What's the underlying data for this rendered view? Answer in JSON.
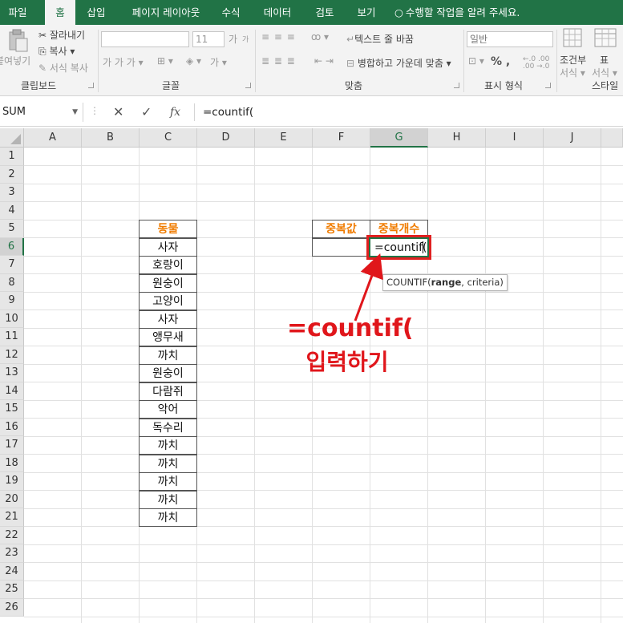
{
  "tabs": [
    {
      "label": "파일",
      "active": false
    },
    {
      "label": "홈",
      "active": true
    },
    {
      "label": "삽입",
      "active": false
    },
    {
      "label": "페이지 레이아웃",
      "active": false
    },
    {
      "label": "수식",
      "active": false
    },
    {
      "label": "데이터",
      "active": false
    },
    {
      "label": "검토",
      "active": false
    },
    {
      "label": "보기",
      "active": false
    }
  ],
  "tell_me": "수행할 작업을 알려 주세요.",
  "ribbon": {
    "clipboard": {
      "paste": "붙여넣기",
      "cut": "잘라내기",
      "copy": "복사 ▾",
      "format_painter": "서식 복사",
      "label": "클립보드"
    },
    "font": {
      "size": "11",
      "grow": "가",
      "shrink": "가",
      "styles": "가  가  가 ▾",
      "label": "글꼴",
      "highlight": "가 ▾"
    },
    "alignment": {
      "wrap": "텍스트 줄 바꿈",
      "merge": "병합하고 가운데 맞춤 ▾",
      "label": "맞춤"
    },
    "number": {
      "format": "일반",
      "symbols": "% ,",
      "label": "표시 형식"
    },
    "styles": {
      "conditional": "조건부",
      "conditional2": "서식 ▾",
      "table": "표",
      "table2": "서식 ▾",
      "label": "스타일"
    }
  },
  "formula_bar": {
    "name_box": "SUM",
    "cancel": "✕",
    "enter": "✓",
    "fx": "fx",
    "formula": "=countif("
  },
  "columns": [
    "A",
    "B",
    "C",
    "D",
    "E",
    "F",
    "G",
    "H",
    "I",
    "J"
  ],
  "rows": [
    "1",
    "2",
    "3",
    "4",
    "5",
    "6",
    "7",
    "8",
    "9",
    "10",
    "11",
    "12",
    "13",
    "14",
    "15",
    "16",
    "17",
    "18",
    "19",
    "20",
    "21",
    "22",
    "23",
    "24",
    "25",
    "26"
  ],
  "sheet": {
    "animal_header": "동물",
    "animals": [
      "사자",
      "호랑이",
      "원숭이",
      "고양이",
      "사자",
      "앵무새",
      "까치",
      "원숭이",
      "다람쥐",
      "악어",
      "독수리",
      "까치",
      "까치",
      "까치",
      "까치",
      "까치"
    ],
    "dup_value_header": "중복값",
    "dup_count_header": "중복개수",
    "dup_value": "",
    "active_cell_text": "=countif(",
    "tooltip_fn": "COUNTIF(",
    "tooltip_arg1": "range",
    "tooltip_rest": ", criteria)"
  },
  "annotation": {
    "line1": "=countif(",
    "line2": "입력하기",
    "color": "#e0161b"
  },
  "colors": {
    "excel_green": "#217346",
    "header_orange": "#f07c00",
    "highlight_red": "#e02020"
  }
}
